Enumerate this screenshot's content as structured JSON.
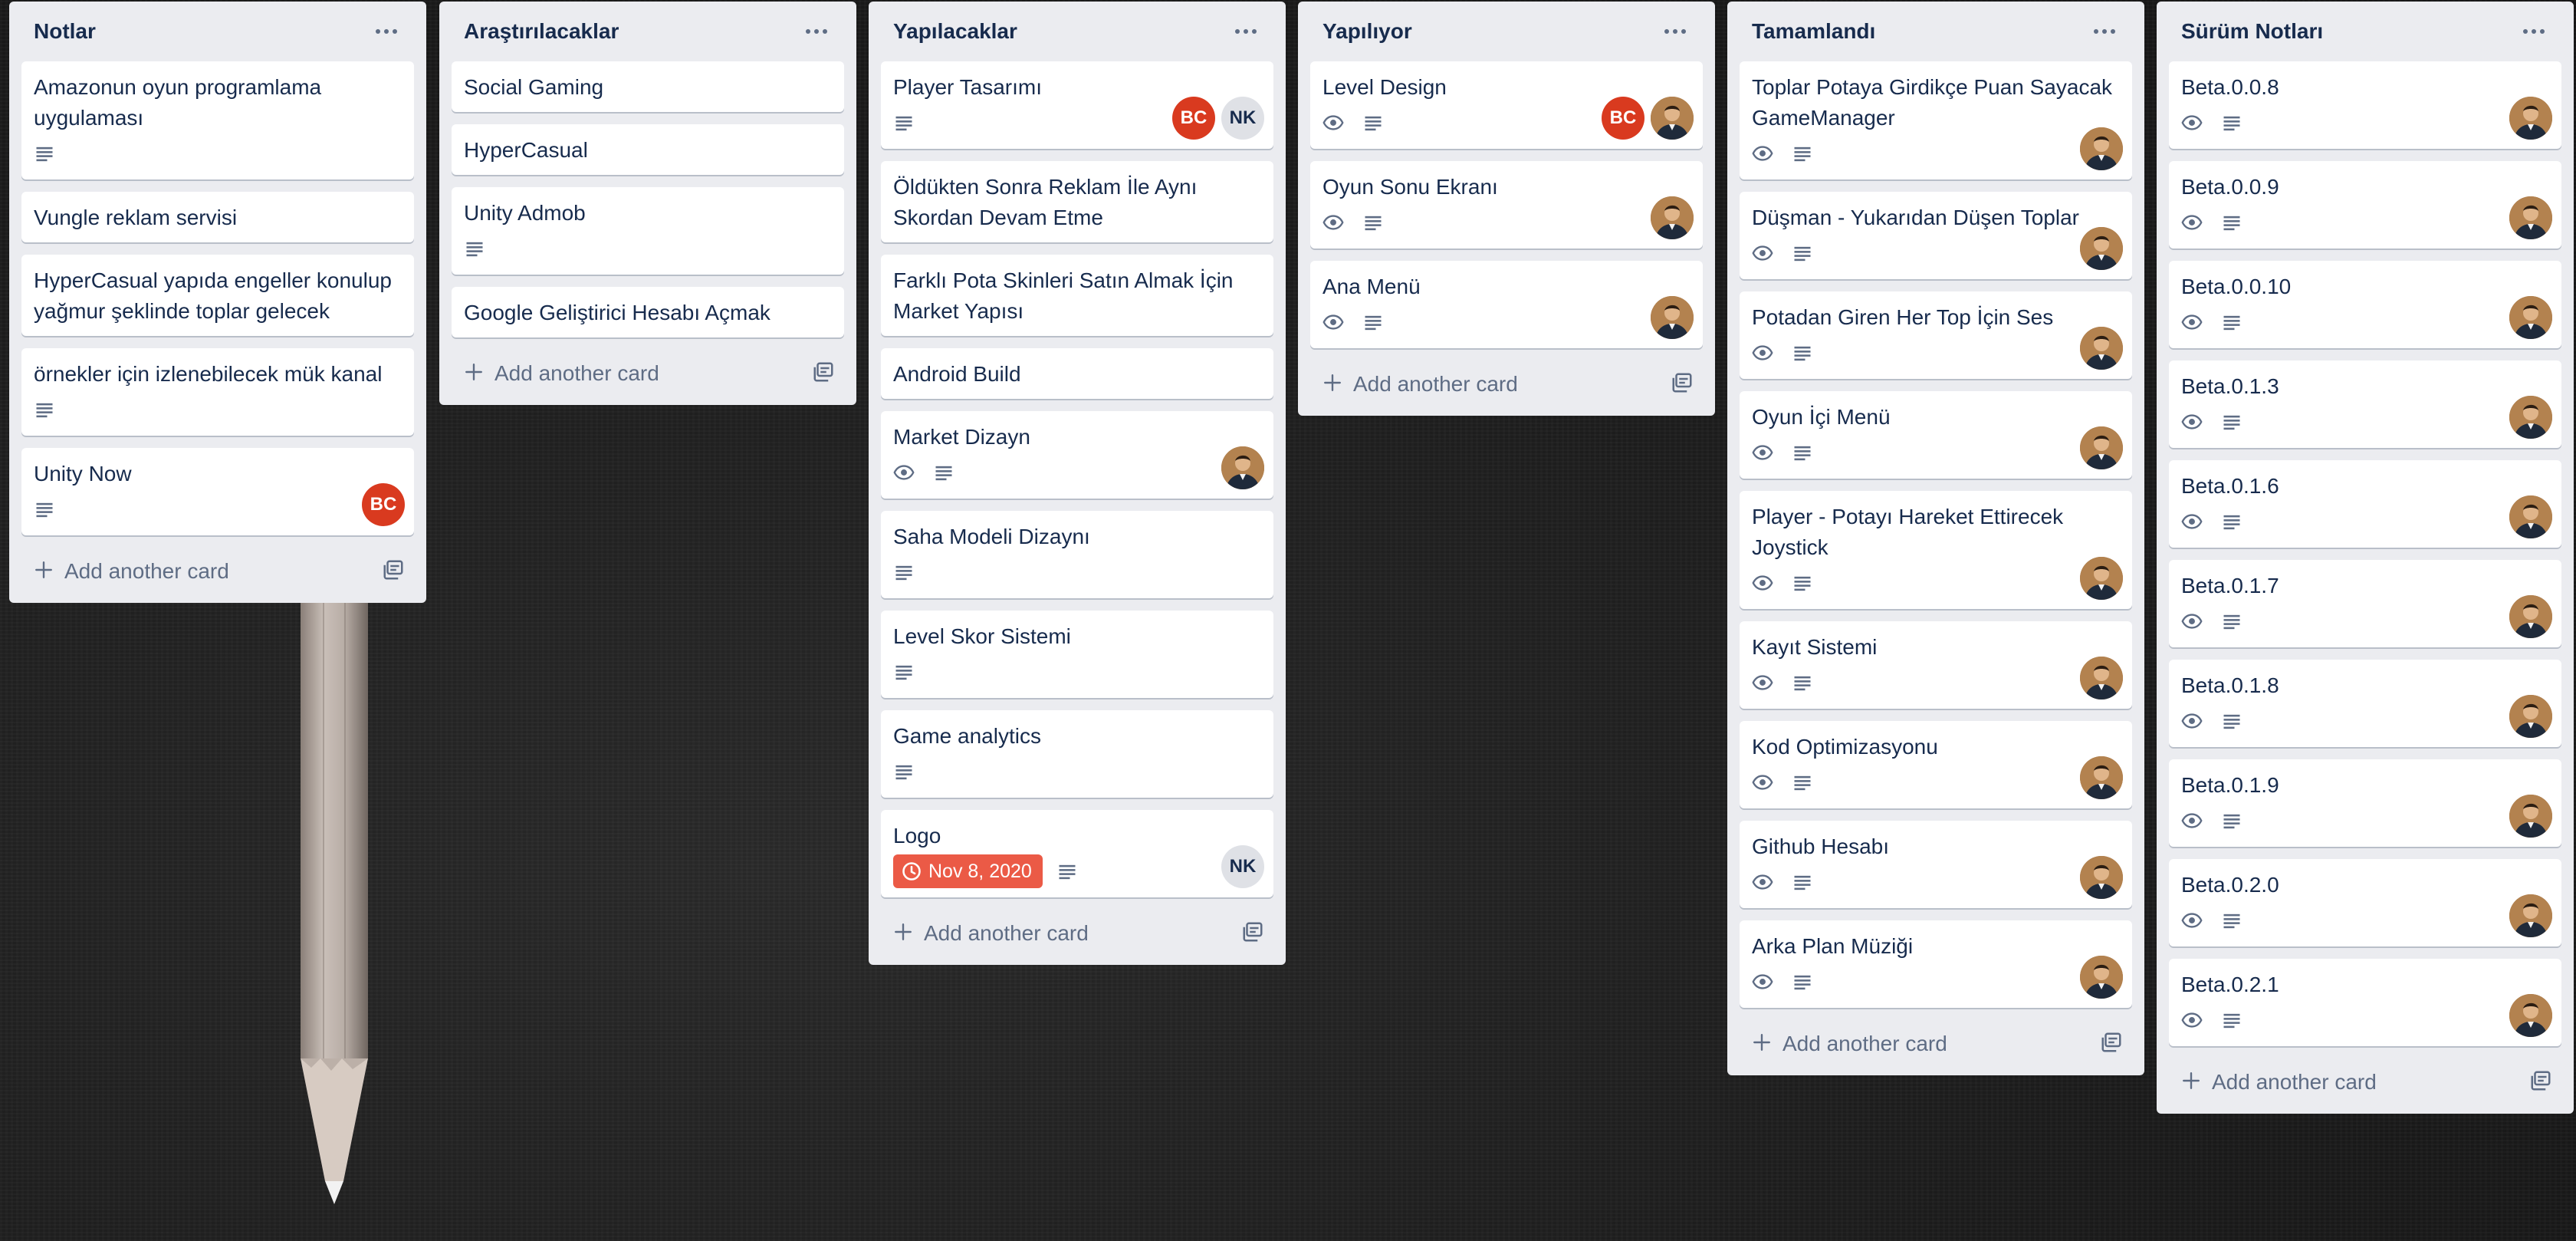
{
  "board": {
    "add_card_label": "Add another card",
    "lists": [
      {
        "title": "Notlar",
        "cards": [
          {
            "title": "Amazonun oyun programlama uygulaması",
            "desc": true
          },
          {
            "title": "Vungle reklam servisi"
          },
          {
            "title": "HyperCasual yapıda engeller konulup yağmur şeklinde toplar gelecek"
          },
          {
            "title": "örnekler için izlenebilecek mük kanal",
            "desc": true
          },
          {
            "title": "Unity Now",
            "desc": true,
            "members": [
              "BC"
            ]
          }
        ]
      },
      {
        "title": "Araştırılacaklar",
        "cards": [
          {
            "title": "Social Gaming"
          },
          {
            "title": "HyperCasual"
          },
          {
            "title": "Unity Admob",
            "desc": true
          },
          {
            "title": "Google Geliştirici Hesabı Açmak"
          }
        ]
      },
      {
        "title": "Yapılacaklar",
        "cards": [
          {
            "title": "Player Tasarımı",
            "desc": true,
            "members": [
              "BC",
              "NK"
            ]
          },
          {
            "title": "Öldükten Sonra Reklam İle Aynı Skordan Devam Etme"
          },
          {
            "title": "Farklı Pota Skinleri Satın Almak İçin Market Yapısı"
          },
          {
            "title": "Android Build"
          },
          {
            "title": "Market Dizayn",
            "watch": true,
            "desc": true,
            "members": [
              "photo"
            ]
          },
          {
            "title": "Saha Modeli Dizaynı",
            "desc": true
          },
          {
            "title": "Level Skor Sistemi",
            "desc": true
          },
          {
            "title": "Game analytics",
            "desc": true
          },
          {
            "title": "Logo",
            "due": "Nov 8, 2020",
            "desc": true,
            "members": [
              "NK"
            ]
          }
        ]
      },
      {
        "title": "Yapılıyor",
        "cards": [
          {
            "title": "Level Design",
            "watch": true,
            "desc": true,
            "members": [
              "BC",
              "photo"
            ]
          },
          {
            "title": "Oyun Sonu Ekranı",
            "watch": true,
            "desc": true,
            "members": [
              "photo"
            ]
          },
          {
            "title": "Ana Menü",
            "watch": true,
            "desc": true,
            "members": [
              "photo"
            ]
          }
        ]
      },
      {
        "title": "Tamamlandı",
        "cards": [
          {
            "title": "Toplar Potaya Girdikçe Puan Sayacak GameManager",
            "watch": true,
            "desc": true,
            "members": [
              "photo"
            ]
          },
          {
            "title": "Düşman - Yukarıdan Düşen Toplar",
            "watch": true,
            "desc": true,
            "members": [
              "photo"
            ]
          },
          {
            "title": "Potadan Giren Her Top İçin Ses",
            "watch": true,
            "desc": true,
            "members": [
              "photo"
            ]
          },
          {
            "title": "Oyun İçi Menü",
            "watch": true,
            "desc": true,
            "members": [
              "photo"
            ]
          },
          {
            "title": "Player - Potayı Hareket Ettirecek Joystick",
            "watch": true,
            "desc": true,
            "members": [
              "photo"
            ]
          },
          {
            "title": "Kayıt Sistemi",
            "watch": true,
            "desc": true,
            "members": [
              "photo"
            ]
          },
          {
            "title": "Kod Optimizasyonu",
            "watch": true,
            "desc": true,
            "members": [
              "photo"
            ]
          },
          {
            "title": "Github Hesabı",
            "watch": true,
            "desc": true,
            "members": [
              "photo"
            ]
          },
          {
            "title": "Arka Plan Müziği",
            "watch": true,
            "desc": true,
            "members": [
              "photo"
            ]
          }
        ]
      },
      {
        "title": "Sürüm Notları",
        "cards": [
          {
            "title": "Beta.0.0.8",
            "watch": true,
            "desc": true,
            "members": [
              "photo"
            ]
          },
          {
            "title": "Beta.0.0.9",
            "watch": true,
            "desc": true,
            "members": [
              "photo"
            ]
          },
          {
            "title": "Beta.0.0.10",
            "watch": true,
            "desc": true,
            "members": [
              "photo"
            ]
          },
          {
            "title": "Beta.0.1.3",
            "watch": true,
            "desc": true,
            "members": [
              "photo"
            ]
          },
          {
            "title": "Beta.0.1.6",
            "watch": true,
            "desc": true,
            "members": [
              "photo"
            ]
          },
          {
            "title": "Beta.0.1.7",
            "watch": true,
            "desc": true,
            "members": [
              "photo"
            ]
          },
          {
            "title": "Beta.0.1.8",
            "watch": true,
            "desc": true,
            "members": [
              "photo"
            ]
          },
          {
            "title": "Beta.0.1.9",
            "watch": true,
            "desc": true,
            "members": [
              "photo"
            ]
          },
          {
            "title": "Beta.0.2.0",
            "watch": true,
            "desc": true,
            "members": [
              "photo"
            ]
          },
          {
            "title": "Beta.0.2.1",
            "watch": true,
            "desc": true,
            "members": [
              "photo"
            ]
          }
        ]
      }
    ]
  },
  "colors": {
    "list_bg": "#ebecf0",
    "card_bg": "#ffffff",
    "text": "#172b4d",
    "muted": "#5e6c84",
    "due_badge": "#eb5a46",
    "member_bc": "#d93a1f",
    "member_nk": "#dfe1e6"
  },
  "icons": [
    "more-icon",
    "eye-icon",
    "description-icon",
    "clock-icon",
    "plus-icon",
    "template-icon"
  ]
}
